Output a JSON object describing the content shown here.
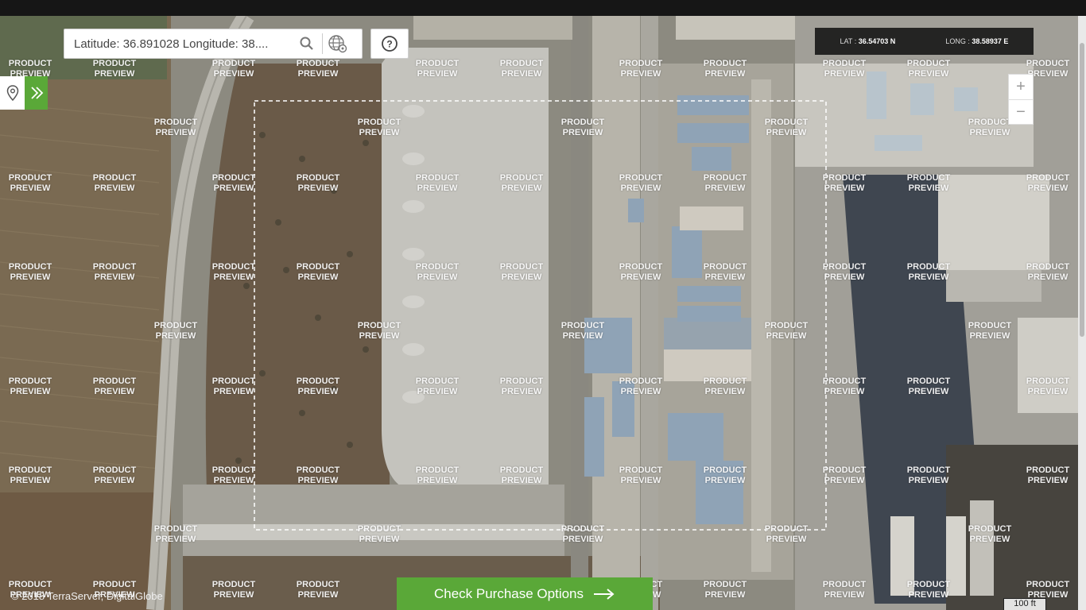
{
  "search": {
    "placeholder": "Latitude: 36.891028 Longitude: 38....",
    "icon": "search-icon",
    "globe_icon": "globe-settings-icon"
  },
  "help": {
    "icon": "help-icon"
  },
  "sidebar": {
    "pin_icon": "map-pin-icon",
    "expand_icon": "double-chevron-right-icon"
  },
  "coordinates": {
    "lat_label": "LAT :",
    "lat_value": "36.54703 N",
    "long_label": "LONG :",
    "long_value": "38.58937 E"
  },
  "zoom": {
    "in": "+",
    "out": "−"
  },
  "purchase": {
    "label": "Check Purchase Options",
    "icon": "arrow-right-icon"
  },
  "copyright": "© 2018 TerraServer, DigitalGlobe",
  "scale": "100 ft",
  "watermark": {
    "line1": "PRODUCT",
    "line2": "PREVIEW"
  },
  "colors": {
    "accent": "#5aa838",
    "topbar": "#161616"
  }
}
